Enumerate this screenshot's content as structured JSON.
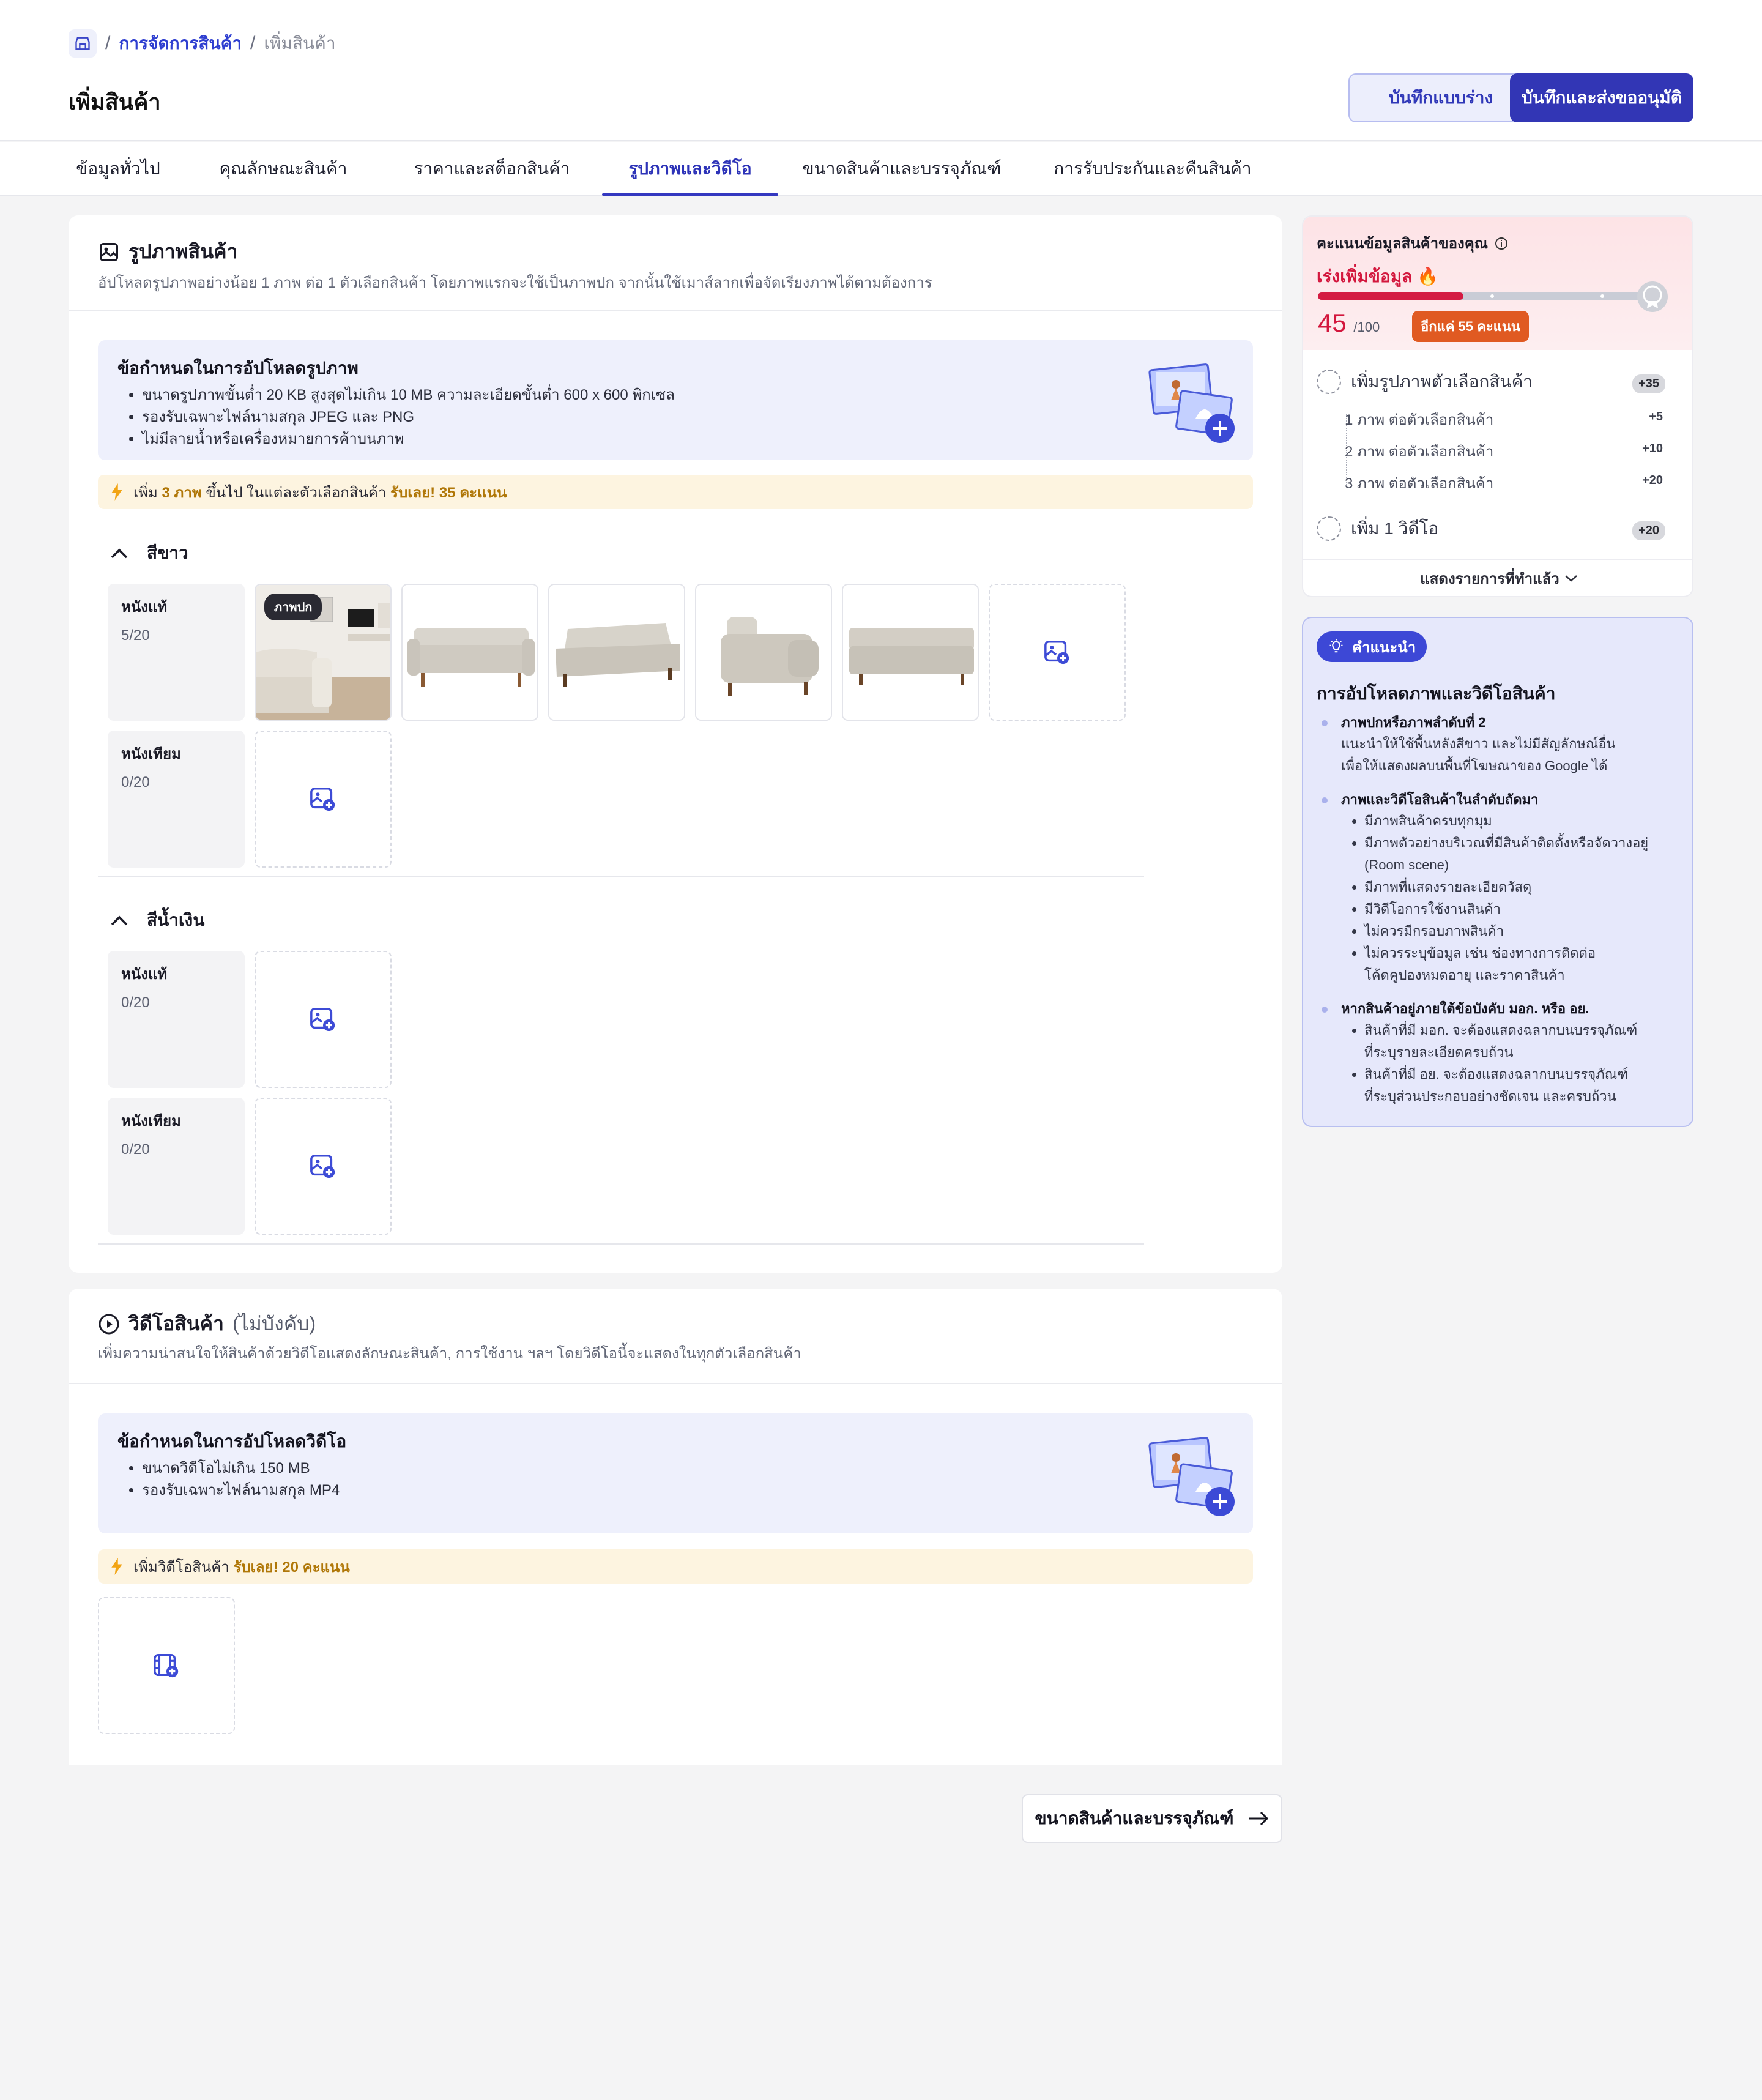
{
  "breadcrumb": {
    "parent": "การจัดการสินค้า",
    "current": "เพิ่มสินค้า"
  },
  "page_title": "เพิ่มสินค้า",
  "actions": {
    "draft": "บันทึกแบบร่าง",
    "submit": "บันทึกและส่งขออนุมัติ"
  },
  "tabs": [
    {
      "label": "ข้อมูลทั่วไป"
    },
    {
      "label": "คุณลักษณะสินค้า"
    },
    {
      "label": "ราคาและสต็อกสินค้า"
    },
    {
      "label": "รูปภาพและวิดีโอ",
      "active": true
    },
    {
      "label": "ขนาดสินค้าและบรรจุภัณฑ์"
    },
    {
      "label": "การรับประกันและคืนสินค้า"
    }
  ],
  "photo_section": {
    "title": "รูปภาพสินค้า",
    "desc": "อัปโหลดรูปภาพอย่างน้อย 1 ภาพ ต่อ 1 ตัวเลือกสินค้า โดยภาพแรกจะใช้เป็นภาพปก จากนั้นใช้เมาส์ลากเพื่อจัดเรียงภาพได้ตามต้องการ",
    "req_title": "ข้อกำหนดในการอัปโหลดรูปภาพ",
    "req_items": [
      "ขนาดรูปภาพขั้นต่ำ 20 KB สูงสุดไม่เกิน 10 MB ความละเอียดขั้นต่ำ 600 x 600 พิกเซล",
      "รองรับเฉพาะไฟล์นามสกุล JPEG และ PNG",
      "ไม่มีลายน้ำหรือเครื่องหมายการค้าบนภาพ"
    ],
    "tip_pre": "เพิ่ม",
    "tip_count": "3 ภาพ",
    "tip_mid": "ขึ้นไป ในแต่ละตัวเลือกสินค้า",
    "tip_reward": "รับเลย! 35 คะแนน",
    "cover_label": "ภาพปก",
    "groups": [
      {
        "name": "สีขาว",
        "rows": [
          {
            "label": "หนังแท้",
            "count": "5/20"
          },
          {
            "label": "หนังเทียม",
            "count": "0/20"
          }
        ]
      },
      {
        "name": "สีน้ำเงิน",
        "rows": [
          {
            "label": "หนังแท้",
            "count": "0/20"
          },
          {
            "label": "หนังเทียม",
            "count": "0/20"
          }
        ]
      }
    ]
  },
  "video_section": {
    "title": "วิดีโอสินค้า",
    "optional": "(ไม่บังคับ)",
    "desc": "เพิ่มความน่าสนใจให้สินค้าด้วยวิดีโอแสดงลักษณะสินค้า, การใช้งาน ฯลฯ โดยวิดีโอนี้จะแสดงในทุกตัวเลือกสินค้า",
    "req_title": "ข้อกำหนดในการอัปโหลดวิดีโอ",
    "req_items": [
      "ขนาดวิดีโอไม่เกิน 150 MB",
      "รองรับเฉพาะไฟล์นามสกุล MP4"
    ],
    "tip_text": "เพิ่มวิดีโอสินค้า",
    "tip_reward": "รับเลย! 20 คะแนน"
  },
  "next_button": "ขนาดสินค้าและบรรจุภัณฑ์",
  "score": {
    "title": "คะแนนข้อมูลสินค้าของคุณ",
    "status": "เร่งเพิ่มข้อมูล",
    "value": "45",
    "max": "/100",
    "progress": 0.45,
    "remaining": "อีกแค่ 55 คะแนน",
    "tasks": [
      {
        "label": "เพิ่มรูปภาพตัวเลือกสินค้า",
        "points": "+35",
        "subs": [
          {
            "label": "1 ภาพ ต่อตัวเลือกสินค้า",
            "points": "+5"
          },
          {
            "label": "2 ภาพ ต่อตัวเลือกสินค้า",
            "points": "+10"
          },
          {
            "label": "3 ภาพ ต่อตัวเลือกสินค้า",
            "points": "+20"
          }
        ]
      },
      {
        "label": "เพิ่ม 1 วิดีโอ",
        "points": "+20"
      }
    ],
    "show_done": "แสดงรายการที่ทำแล้ว"
  },
  "advice": {
    "badge": "คำแนะนำ",
    "title": "การอัปโหลดภาพและวิดีโอสินค้า",
    "b1_title": "ภาพปกหรือภาพลำดับที่ 2",
    "b1_text": [
      "แนะนำให้ใช้พื้นหลังสีขาว และไม่มีสัญลักษณ์อื่น",
      "เพื่อให้แสดงผลบนพื้นที่โฆษณาของ Google ได้"
    ],
    "b2_title": "ภาพและวิดีโอสินค้าในลำดับถัดมา",
    "b2_items": [
      "มีภาพสินค้าครบทุกมุม",
      "มีภาพตัวอย่างบริเวณที่มีสินค้าติดตั้งหรือจัดวางอยู่",
      "(Room scene)",
      "มีภาพที่แสดงรายละเอียดวัสดุ",
      "มีวิดีโอการใช้งานสินค้า",
      "ไม่ควรมีกรอบภาพสินค้า",
      "ไม่ควรระบุข้อมูล เช่น ช่องทางการติดต่อ",
      "โค้ดคูปองหมดอายุ และราคาสินค้า"
    ],
    "b3_title": "หากสินค้าอยู่ภายใต้ข้อบังคับ มอก. หรือ อย.",
    "b3_items": [
      "สินค้าที่มี มอก. จะต้องแสดงฉลากบนบรรจุภัณฑ์",
      "ที่ระบุรายละเอียดครบถ้วน",
      "สินค้าที่มี อย. จะต้องแสดงฉลากบนบรรจุภัณฑ์",
      "ที่ระบุส่วนประกอบอย่างชัดเจน และครบถ้วน"
    ]
  }
}
